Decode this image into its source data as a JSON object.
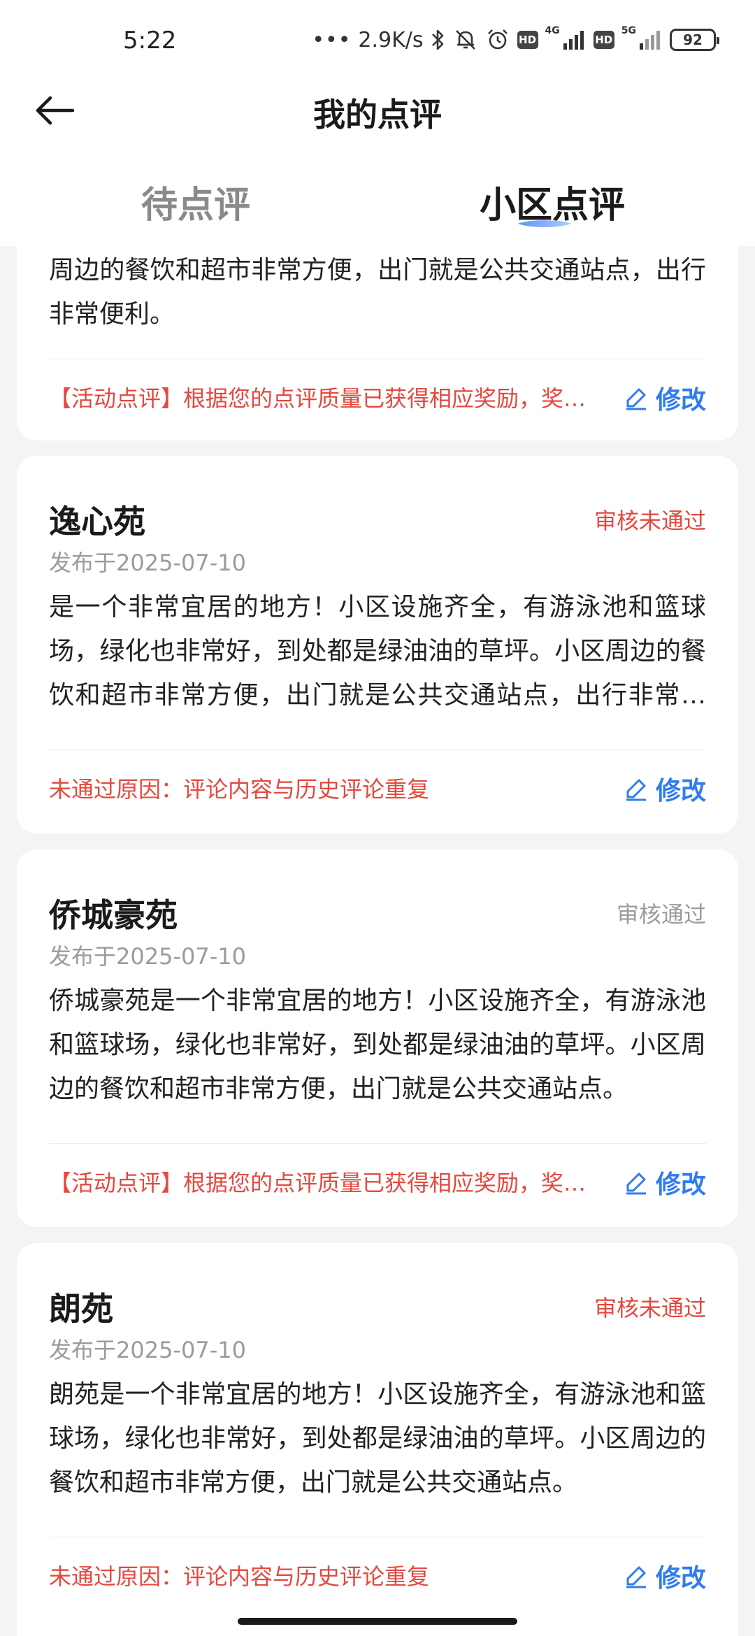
{
  "status_bar": {
    "time": "5:22",
    "dots": "•••",
    "net_speed": "2.9K/s",
    "hd1": "HD",
    "net1": "4G",
    "hd2": "HD",
    "net2": "5G",
    "battery": "92"
  },
  "header": {
    "title": "我的点评"
  },
  "tabs": [
    {
      "label": "待点评",
      "active": false
    },
    {
      "label": "小区点评",
      "active": true
    }
  ],
  "edit_label": "修改",
  "reviews": [
    {
      "text": "池和篮球场，绿化也非常好，到处都是绿油油的草坪。小区周边的餐饮和超市非常方便，出门就是公共交通站点，出行非常便利。",
      "footnote": "【活动点评】根据您的点评质量已获得相应奖励，奖励已发放至您的账户",
      "footnote_type": "activity"
    },
    {
      "name": "逸心苑",
      "status": "审核未通过",
      "status_type": "fail",
      "date": "发布于2025-07-10",
      "text": "是一个非常宜居的地方！小区设施齐全，有游泳池和篮球场，绿化也非常好，到处都是绿油油的草坪。小区周边的餐饮和超市非常方便，出门就是公共交通站点，出行非常便利。",
      "footnote": "未通过原因：评论内容与历史评论重复",
      "footnote_type": "reason"
    },
    {
      "name": "侨城豪苑",
      "status": "审核通过",
      "status_type": "pass",
      "date": "发布于2025-07-10",
      "text": "侨城豪苑是一个非常宜居的地方！小区设施齐全，有游泳池和篮球场，绿化也非常好，到处都是绿油油的草坪。小区周边的餐饮和超市非常方便，出门就是公共交通站点。",
      "footnote": "【活动点评】根据您的点评质量已获得相应奖励，奖励已发放至您的账户",
      "footnote_type": "activity"
    },
    {
      "name": "朗苑",
      "status": "审核未通过",
      "status_type": "fail",
      "date": "发布于2025-07-10",
      "text": "朗苑是一个非常宜居的地方！小区设施齐全，有游泳池和篮球场，绿化也非常好，到处都是绿油油的草坪。小区周边的餐饮和超市非常方便，出门就是公共交通站点。",
      "footnote": "未通过原因：评论内容与历史评论重复",
      "footnote_type": "reason"
    }
  ]
}
